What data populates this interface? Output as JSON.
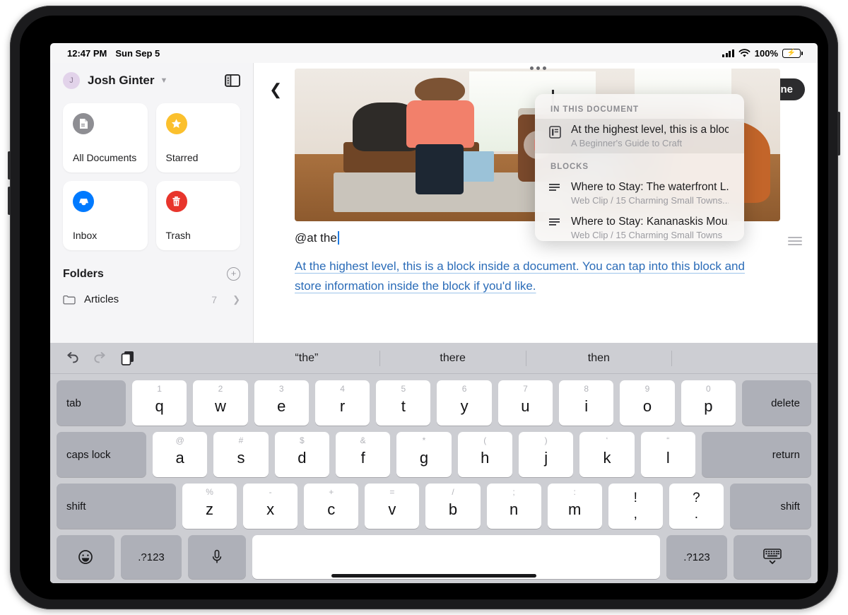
{
  "status_bar": {
    "time": "12:47 PM",
    "date": "Sun Sep 5",
    "battery_percent": "100%"
  },
  "sidebar": {
    "account": {
      "initial": "J",
      "name": "Josh Ginter"
    },
    "tiles": [
      {
        "label": "All Documents",
        "icon": "document-icon",
        "color": "#8e8e93"
      },
      {
        "label": "Starred",
        "icon": "star-icon",
        "color": "#fbc02d"
      },
      {
        "label": "Inbox",
        "icon": "inbox-icon",
        "color": "#007aff"
      },
      {
        "label": "Trash",
        "icon": "trash-icon",
        "color": "#e8352c"
      }
    ],
    "folders_title": "Folders",
    "folders": [
      {
        "name": "Articles",
        "count": "7"
      }
    ]
  },
  "editor": {
    "done_label": "Done",
    "typed_line": "@at the",
    "block_text": "At the highest level, this is a block inside a document. You can tap into this block and store information inside the block if you'd like.",
    "block_link_color": "#2b6cb8"
  },
  "dropdown": {
    "section_1_title": "IN THIS DOCUMENT",
    "section_1_items": [
      {
        "title": "At the highest level, this is a bloc...",
        "subtitle": "A Beginner's Guide to Craft",
        "icon": "document-block-icon",
        "selected": true
      }
    ],
    "section_2_title": "BLOCKS",
    "section_2_items": [
      {
        "title": "Where to Stay: The waterfront L...",
        "subtitle": "Web Clip / 15 Charming Small Towns...",
        "icon": "text-block-icon",
        "selected": false
      },
      {
        "title": "Where to Stay: Kananaskis Mou...",
        "subtitle": "Web Clip / 15 Charming Small Towns",
        "icon": "text-block-icon",
        "selected": false
      }
    ]
  },
  "keyboard": {
    "suggestions": [
      "“the”",
      "there",
      "then"
    ],
    "tools": [
      "undo-icon",
      "redo-icon",
      "paste-icon"
    ],
    "row1": {
      "tab": "tab",
      "keys": [
        {
          "sup": "1",
          "lbl": "q"
        },
        {
          "sup": "2",
          "lbl": "w"
        },
        {
          "sup": "3",
          "lbl": "e"
        },
        {
          "sup": "4",
          "lbl": "r"
        },
        {
          "sup": "5",
          "lbl": "t"
        },
        {
          "sup": "6",
          "lbl": "y"
        },
        {
          "sup": "7",
          "lbl": "u"
        },
        {
          "sup": "8",
          "lbl": "i"
        },
        {
          "sup": "9",
          "lbl": "o"
        },
        {
          "sup": "0",
          "lbl": "p"
        }
      ],
      "delete": "delete"
    },
    "row2": {
      "caps": "caps lock",
      "keys": [
        {
          "sup": "@",
          "lbl": "a"
        },
        {
          "sup": "#",
          "lbl": "s"
        },
        {
          "sup": "$",
          "lbl": "d"
        },
        {
          "sup": "&",
          "lbl": "f"
        },
        {
          "sup": "*",
          "lbl": "g"
        },
        {
          "sup": "(",
          "lbl": "h"
        },
        {
          "sup": ")",
          "lbl": "j"
        },
        {
          "sup": "‘",
          "lbl": "k"
        },
        {
          "sup": "“",
          "lbl": "l"
        }
      ],
      "return": "return"
    },
    "row3": {
      "shift_left": "shift",
      "keys": [
        {
          "sup": "%",
          "lbl": "z"
        },
        {
          "sup": "-",
          "lbl": "x"
        },
        {
          "sup": "+",
          "lbl": "c"
        },
        {
          "sup": "=",
          "lbl": "v"
        },
        {
          "sup": "/",
          "lbl": "b"
        },
        {
          "sup": ";",
          "lbl": "n"
        },
        {
          "sup": ":",
          "lbl": "m"
        }
      ],
      "punct": [
        {
          "up": "!",
          "dn": ","
        },
        {
          "up": "?",
          "dn": "."
        }
      ],
      "shift_right": "shift"
    },
    "row4": {
      "emoji": "emoji-icon",
      "num_left": ".?123",
      "mic": "microphone-icon",
      "space": "",
      "num_right": ".?123",
      "dismiss": "dismiss-keyboard-icon"
    }
  }
}
